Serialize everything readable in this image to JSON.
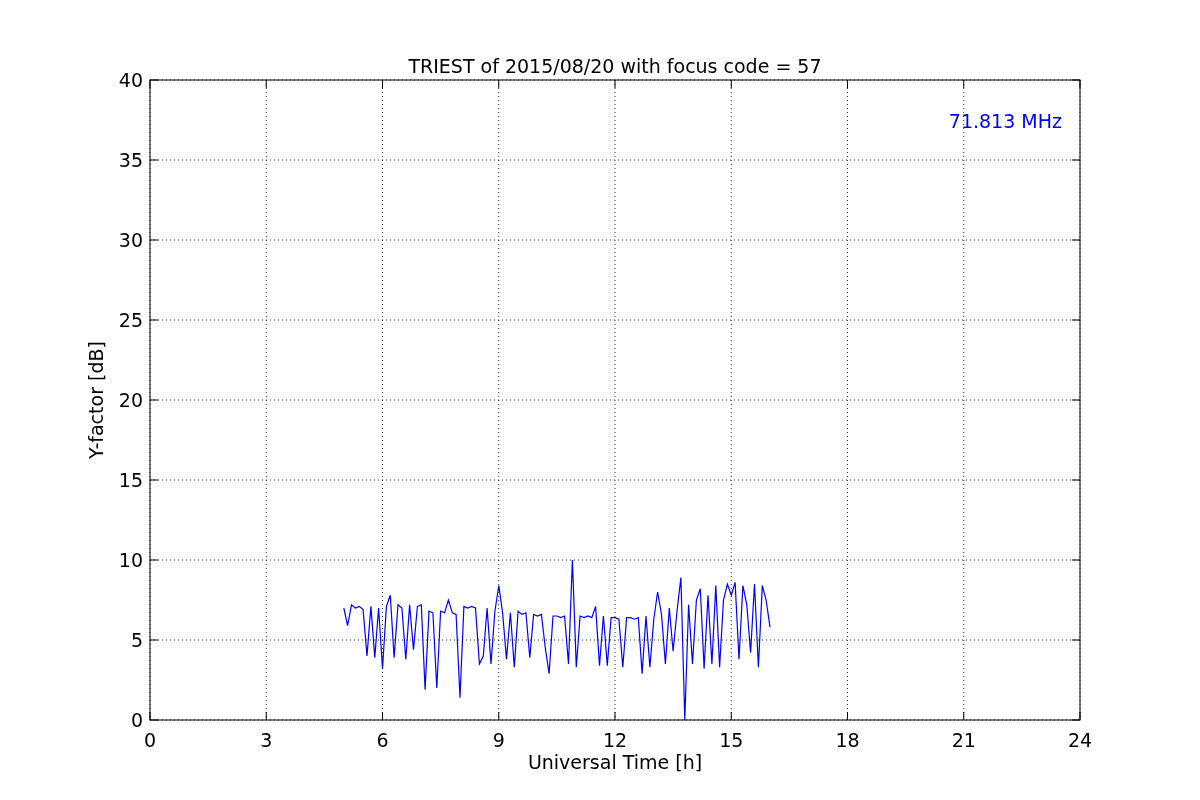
{
  "chart": {
    "chart_data": {
      "type": "line",
      "title": "TRIEST of 2015/08/20 with focus code = 57",
      "xlabel": "Universal Time [h]",
      "ylabel": "Y-factor [dB]",
      "x": [
        5.0,
        5.1,
        5.2,
        5.3,
        5.4,
        5.5,
        5.6,
        5.7,
        5.8,
        5.9,
        6.0,
        6.1,
        6.2,
        6.3,
        6.4,
        6.5,
        6.6,
        6.7,
        6.8,
        6.9,
        7.0,
        7.1,
        7.2,
        7.3,
        7.4,
        7.5,
        7.6,
        7.7,
        7.8,
        7.9,
        8.0,
        8.1,
        8.2,
        8.3,
        8.4,
        8.5,
        8.6,
        8.7,
        8.8,
        8.9,
        9.0,
        9.1,
        9.2,
        9.3,
        9.4,
        9.5,
        9.6,
        9.7,
        9.8,
        9.9,
        10.0,
        10.1,
        10.2,
        10.3,
        10.4,
        10.5,
        10.6,
        10.7,
        10.8,
        10.9,
        11.0,
        11.1,
        11.2,
        11.3,
        11.4,
        11.5,
        11.6,
        11.7,
        11.8,
        11.9,
        12.0,
        12.1,
        12.2,
        12.3,
        12.4,
        12.5,
        12.6,
        12.7,
        12.8,
        12.9,
        13.0,
        13.1,
        13.2,
        13.3,
        13.4,
        13.5,
        13.6,
        13.7,
        13.8,
        13.9,
        14.0,
        14.1,
        14.2,
        14.3,
        14.4,
        14.5,
        14.6,
        14.7,
        14.8,
        14.9,
        15.0,
        15.1,
        15.2,
        15.3,
        15.4,
        15.5,
        15.6,
        15.7,
        15.8,
        15.9,
        16.0
      ],
      "series": [
        {
          "name": "71.813 MHz",
          "color": "#0000ff",
          "values": [
            7.0,
            5.9,
            7.2,
            7.0,
            7.1,
            6.9,
            4.0,
            7.1,
            3.9,
            7.0,
            3.2,
            7.1,
            7.8,
            3.9,
            7.2,
            7.0,
            3.8,
            7.2,
            4.4,
            7.1,
            7.2,
            1.9,
            6.8,
            6.7,
            2.0,
            6.8,
            6.7,
            7.5,
            6.7,
            6.6,
            1.4,
            7.1,
            7.0,
            7.1,
            7.0,
            3.5,
            4.0,
            7.0,
            3.5,
            6.8,
            8.4,
            6.7,
            3.8,
            6.7,
            3.3,
            6.8,
            6.6,
            6.7,
            3.9,
            6.6,
            6.5,
            6.6,
            4.5,
            2.9,
            6.5,
            6.5,
            6.4,
            6.5,
            3.5,
            10.0,
            3.3,
            6.5,
            6.4,
            6.5,
            6.4,
            7.1,
            3.4,
            6.5,
            3.4,
            6.4,
            6.4,
            6.3,
            3.3,
            6.4,
            6.4,
            6.3,
            6.4,
            2.9,
            6.5,
            3.3,
            6.3,
            8.0,
            6.6,
            3.5,
            7.0,
            4.3,
            6.8,
            8.9,
            0.0,
            7.2,
            3.5,
            7.5,
            8.2,
            3.2,
            7.8,
            3.5,
            8.4,
            3.3,
            7.5,
            8.5,
            7.8,
            8.6,
            3.8,
            8.4,
            7.2,
            4.2,
            8.5,
            3.3,
            8.4,
            7.5,
            5.8
          ]
        }
      ],
      "xlim": [
        0,
        24
      ],
      "ylim": [
        0,
        40
      ],
      "xticks": [
        0,
        3,
        6,
        9,
        12,
        15,
        18,
        21,
        24
      ],
      "yticks": [
        0,
        5,
        10,
        15,
        20,
        25,
        30,
        35,
        40
      ],
      "grid": true
    }
  }
}
